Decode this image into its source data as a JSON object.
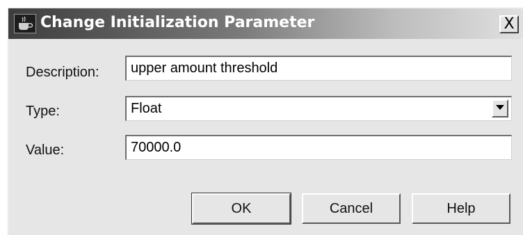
{
  "window": {
    "title": "Change Initialization Parameter",
    "close_label": "X",
    "app_icon": "java-cup-icon"
  },
  "form": {
    "description": {
      "label": "Description:",
      "value": "upper amount threshold"
    },
    "type": {
      "label": "Type:",
      "value": "Float"
    },
    "value": {
      "label": "Value:",
      "value": "70000.0"
    }
  },
  "buttons": {
    "ok": "OK",
    "cancel": "Cancel",
    "help": "Help"
  }
}
